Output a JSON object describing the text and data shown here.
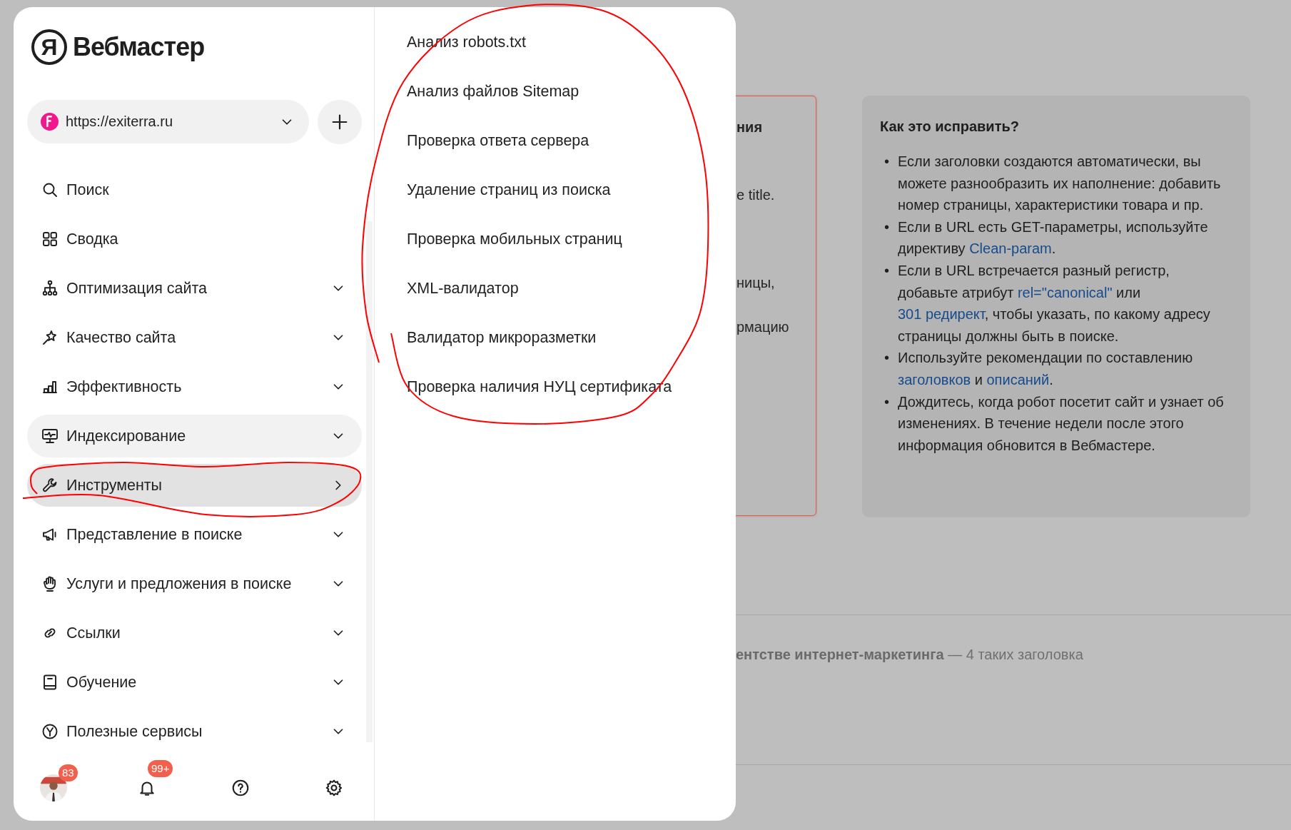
{
  "logo": {
    "mark": "Я",
    "title": "Вебмастер"
  },
  "site_selector": {
    "value": "https://exiterra.ru"
  },
  "menu": [
    {
      "label": "Поиск",
      "kind": "plain",
      "selected": false,
      "hovered": false
    },
    {
      "label": "Сводка",
      "kind": "plain",
      "selected": false,
      "hovered": false
    },
    {
      "label": "Оптимизация сайта",
      "kind": "group",
      "selected": false,
      "hovered": false
    },
    {
      "label": "Качество сайта",
      "kind": "group",
      "selected": false,
      "hovered": false
    },
    {
      "label": "Эффективность",
      "kind": "group",
      "selected": false,
      "hovered": false
    },
    {
      "label": "Индексирование",
      "kind": "group",
      "selected": false,
      "hovered": true
    },
    {
      "label": "Инструменты",
      "kind": "submenu",
      "selected": true,
      "hovered": false
    },
    {
      "label": "Представление в поиске",
      "kind": "group",
      "selected": false,
      "hovered": false
    },
    {
      "label": "Услуги и предложения в поиске",
      "kind": "group",
      "selected": false,
      "hovered": false
    },
    {
      "label": "Ссылки",
      "kind": "group",
      "selected": false,
      "hovered": false
    },
    {
      "label": "Обучение",
      "kind": "group",
      "selected": false,
      "hovered": false
    },
    {
      "label": "Полезные сервисы",
      "kind": "group",
      "selected": false,
      "hovered": false
    }
  ],
  "footer": {
    "profile_badge": "83",
    "notifications_badge": "99+"
  },
  "submenu": {
    "items": [
      "Анализ robots.txt",
      "Анализ файлов Sitemap",
      "Проверка ответа сервера",
      "Удаление страниц из поиска",
      "Проверка мобильных страниц",
      "XML-валидатор",
      "Валидатор микроразметки",
      "Проверка наличия НУЦ сертификата"
    ]
  },
  "background": {
    "card_fragments": [
      {
        "text": "ния",
        "kind": "heading"
      },
      {
        "text": "e title.",
        "kind": "text"
      },
      {
        "text": "ницы,",
        "kind": "text"
      },
      {
        "text": "рмацию",
        "kind": "text"
      }
    ],
    "fix_card": {
      "title": "Как это исправить?",
      "items": [
        {
          "marker": "•",
          "segments": [
            {
              "text": "Если заголовки создаются автоматически, вы можете разнообразить их наполнение: добавить номер страницы, характеристики товара и пр.",
              "kind": "text"
            }
          ]
        },
        {
          "marker": "•",
          "segments": [
            {
              "text": "Если в URL есть GET-параметры, используйте директиву ",
              "kind": "text"
            },
            {
              "text": "Clean-param",
              "kind": "link"
            },
            {
              "text": ".",
              "kind": "text"
            }
          ]
        },
        {
          "marker": "•",
          "segments": [
            {
              "text": "Если в URL встречается разный регистр, добавьте атрибут ",
              "kind": "text"
            },
            {
              "text": "rel=\"canonical\"",
              "kind": "link"
            },
            {
              "text": " или ",
              "kind": "text"
            },
            {
              "text": "301 редирект",
              "kind": "link"
            },
            {
              "text": ", чтобы указать, по какому адресу страницы должны быть в поиске.",
              "kind": "text"
            }
          ]
        },
        {
          "marker": "•",
          "segments": [
            {
              "text": "Используйте рекомендации по составлению ",
              "kind": "text"
            },
            {
              "text": "заголовков",
              "kind": "link"
            },
            {
              "text": " и ",
              "kind": "text"
            },
            {
              "text": "описаний",
              "kind": "link"
            },
            {
              "text": ".",
              "kind": "text"
            }
          ]
        },
        {
          "marker": "•",
          "segments": [
            {
              "text": "Дождитесь, когда робот посетит сайт и узнает об изменениях. В течение недели после этого информация обновится в Вебмастере.",
              "kind": "text"
            }
          ]
        }
      ]
    },
    "result_row": "**ентстве интернет-маркетинга** — 4 таких заголовка"
  },
  "annotations": [
    {
      "kind": "freehand-loop"
    },
    {
      "kind": "freehand-loop"
    }
  ]
}
